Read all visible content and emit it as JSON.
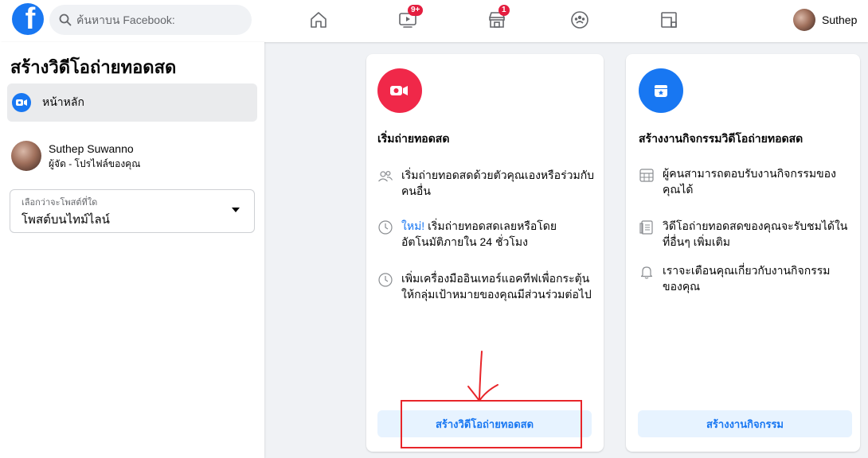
{
  "topbar": {
    "search_placeholder": "ค้นหาบน Facebook:",
    "watch_badge": "9+",
    "marketplace_badge": "1",
    "profile_name": "Suthep",
    "icons": [
      "facebook-logo-icon",
      "search-icon",
      "home-icon",
      "watch-icon",
      "marketplace-icon",
      "groups-icon",
      "gaming-icon"
    ]
  },
  "sidebar": {
    "title": "สร้างวิดีโอถ่ายทอดสด",
    "home_label": "หน้าหลัก",
    "host_name": "Suthep Suwanno",
    "host_role": "ผู้จัด - โปรไฟล์ของคุณ",
    "post_select_label": "เลือกว่าจะโพสต์ที่ใด",
    "post_select_value": "โพสต์บนไทม์ไลน์"
  },
  "live_card": {
    "title": "เริ่มถ่ายทอดสด",
    "icon_color": "#f02849",
    "features": [
      {
        "icon": "people-icon",
        "text": "เริ่มถ่ายทอดสดด้วยตัวคุณเองหรือร่วมกับคนอื่น"
      },
      {
        "icon": "clock-icon",
        "highlight": "ใหม่!",
        "text": " เริ่มถ่ายทอดสดเลยหรือโดยอัตโนมัติภายใน 24 ชั่วโมง"
      },
      {
        "icon": "clock-icon",
        "text": "เพิ่มเครื่องมืออินเทอร์แอคทีฟเพื่อกระตุ้นให้กลุ่มเป้าหมายของคุณมีส่วนร่วมต่อไป"
      }
    ],
    "button_label": "สร้างวิดีโอถ่ายทอดสด"
  },
  "event_card": {
    "title": "สร้างงานกิจกรรมวิดีโอถ่ายทอดสด",
    "icon_color": "#1877f2",
    "features": [
      {
        "icon": "calendar-icon",
        "text": "ผู้คนสามารถตอบรับงานกิจกรรมของคุณได้"
      },
      {
        "icon": "document-icon",
        "text": "วิดีโอถ่ายทอดสดของคุณจะรับชมได้ในที่อื่นๆ เพิ่มเติม"
      },
      {
        "icon": "bell-icon",
        "text": "เราจะเตือนคุณเกี่ยวกับงานกิจกรรมของคุณ"
      }
    ],
    "button_label": "สร้างงานกิจกรรม"
  },
  "colors": {
    "brand": "#1877f2",
    "live_red": "#f02849",
    "annotation_red": "#e8252a",
    "button_bg": "#e7f3ff"
  }
}
